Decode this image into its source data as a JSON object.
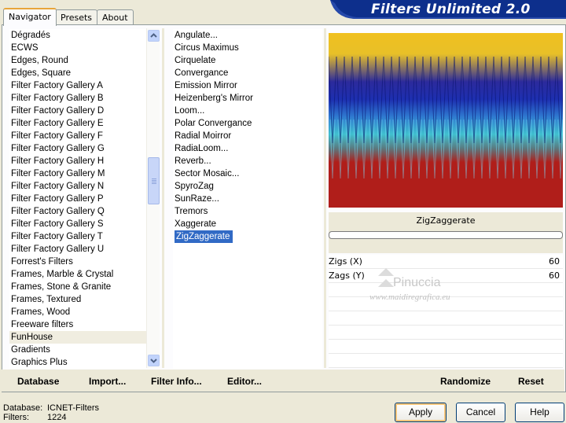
{
  "tabs": [
    "Navigator",
    "Presets",
    "About"
  ],
  "app_title": "Filters Unlimited 2.0",
  "categories": [
    "Dégradés",
    "ECWS",
    "Edges, Round",
    "Edges, Square",
    "Filter Factory Gallery A",
    "Filter Factory Gallery B",
    "Filter Factory Gallery D",
    "Filter Factory Gallery E",
    "Filter Factory Gallery F",
    "Filter Factory Gallery G",
    "Filter Factory Gallery H",
    "Filter Factory Gallery M",
    "Filter Factory Gallery N",
    "Filter Factory Gallery P",
    "Filter Factory Gallery Q",
    "Filter Factory Gallery S",
    "Filter Factory Gallery T",
    "Filter Factory Gallery U",
    "Forrest's Filters",
    "Frames, Marble & Crystal",
    "Frames, Stone & Granite",
    "Frames, Textured",
    "Frames, Wood",
    "Freeware filters",
    "FunHouse",
    "Gradients",
    "Graphics Plus"
  ],
  "selected_category": "FunHouse",
  "filters": [
    "Angulate...",
    "Circus Maximus",
    "Cirquelate",
    "Convergance",
    "Emission Mirror",
    "Heizenberg's Mirror",
    "Loom...",
    "Polar Convergance",
    "Radial Moirror",
    "RadiaLoom...",
    "Reverb...",
    "Sector Mosaic...",
    "SpyroZag",
    "SunRaze...",
    "Tremors",
    "Xaggerate",
    "ZigZaggerate"
  ],
  "selected_filter": "ZigZaggerate",
  "filter_name": "ZigZaggerate",
  "params": [
    {
      "label": "Zigs (X)",
      "value": "60"
    },
    {
      "label": "Zags (Y)",
      "value": "60"
    }
  ],
  "watermark": {
    "name": "Pinuccia",
    "url": "www.maidiregrafica.eu"
  },
  "toolbar": {
    "database": "Database",
    "import": "Import...",
    "filter_info": "Filter Info...",
    "editor": "Editor...",
    "randomize": "Randomize",
    "reset": "Reset"
  },
  "footer": {
    "database_label": "Database:",
    "database_value": "ICNET-Filters",
    "filters_label": "Filters:",
    "filters_value": "1224"
  },
  "buttons": {
    "apply": "Apply",
    "cancel": "Cancel",
    "help": "Help"
  },
  "colors": {
    "accent_select": "#316ac5",
    "banner": "#0d2f8c",
    "preview_yellow": "#f0c020",
    "preview_blue": "#1d2fb0",
    "preview_cyan": "#38b4d8",
    "preview_red": "#b01e1a"
  }
}
